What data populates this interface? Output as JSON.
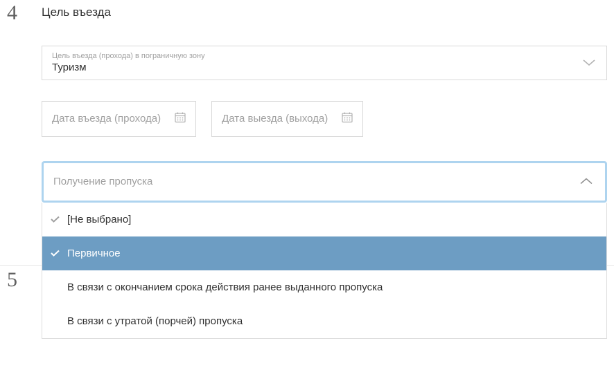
{
  "section4": {
    "number": "4",
    "title": "Цель въезда",
    "purposeField": {
      "label": "Цель въезда (прохода) в пограничную зону",
      "value": "Туризм"
    },
    "entryDate": {
      "placeholder": "Дата въезда (прохода)"
    },
    "exitDate": {
      "placeholder": "Дата выезда (выхода)"
    },
    "passDropdown": {
      "placeholder": "Получение пропуска",
      "options": [
        {
          "label": "[Не выбрано]",
          "checked": true,
          "selected": false
        },
        {
          "label": "Первичное",
          "checked": true,
          "selected": true
        },
        {
          "label": "В связи с окончанием срока действия ранее выданного пропуска",
          "checked": false,
          "selected": false
        },
        {
          "label": "В связи с утратой (порчей) пропуска",
          "checked": false,
          "selected": false
        }
      ]
    }
  },
  "section5": {
    "number": "5"
  }
}
